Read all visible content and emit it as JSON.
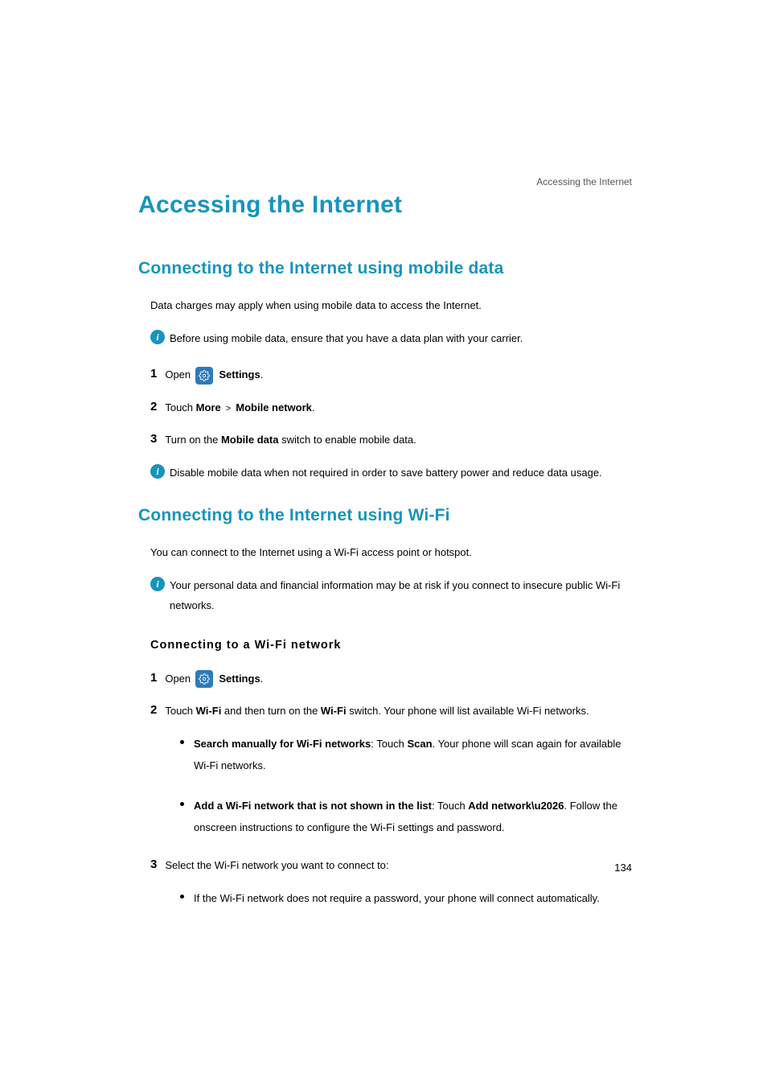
{
  "breadcrumb": "Accessing the Internet",
  "page_title": "Accessing the Internet",
  "page_number": "134",
  "section1": {
    "title": "Connecting to the Internet using mobile data",
    "intro": "Data charges may apply when using mobile data to access the Internet.",
    "info1": "Before using mobile data, ensure that you have a data plan with your carrier.",
    "steps": {
      "n1": "1",
      "s1_a": "Open ",
      "s1_b": "Settings",
      "n2": "2",
      "s2_a": "Touch ",
      "s2_b": "More",
      "s2_c": " > ",
      "s2_d": "Mobile network",
      "n3": "3",
      "s3_a": "Turn on the ",
      "s3_b": "Mobile data",
      "s3_c": " switch to enable mobile data."
    },
    "info2": "Disable mobile data when not required in order to save battery power and reduce data usage."
  },
  "section2": {
    "title": "Connecting to the Internet using Wi-Fi",
    "intro": "You can connect to the Internet using a Wi-Fi access point or hotspot.",
    "info1": "Your personal data and financial information may be at risk if you connect to insecure public Wi-Fi networks.",
    "subsection_title": "Connecting to a Wi-Fi network",
    "steps": {
      "n1": "1",
      "s1_a": "Open ",
      "s1_b": "Settings",
      "n2": "2",
      "s2_a": "Touch ",
      "s2_b": "Wi-Fi",
      "s2_c": " and then turn on the ",
      "s2_d": "Wi-Fi",
      "s2_e": " switch. Your phone will list available Wi-Fi networks.",
      "n3": "3",
      "s3_a": "Select the Wi-Fi network you want to connect to:"
    },
    "bullets1": {
      "b1_a": "Search manually for Wi-Fi networks",
      "b1_b": ": Touch ",
      "b1_c": "Scan",
      "b1_d": ". Your phone will scan again for available Wi-Fi networks.",
      "b2_a": "Add a Wi-Fi network that is not shown in the list",
      "b2_b": ": Touch ",
      "b2_c": "Add network\\u2026",
      "b2_d": ". Follow the onscreen instructions to configure the Wi-Fi settings and password."
    },
    "bullets2": {
      "b1": "If the Wi-Fi network does not require a password, your phone will connect automatically."
    }
  }
}
